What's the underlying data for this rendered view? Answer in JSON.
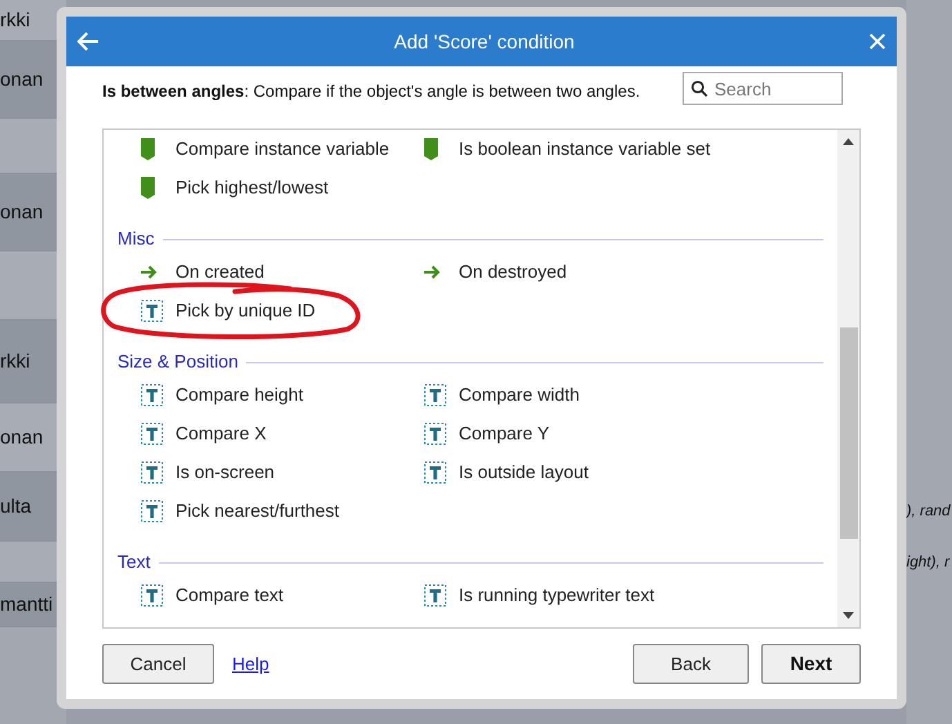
{
  "background": {
    "left_rows": [
      {
        "text": "rkki"
      },
      {
        "text": "onan"
      },
      {
        "text": "onan"
      },
      {
        "text": "rkki"
      },
      {
        "text": "onan"
      },
      {
        "text": "ulta"
      },
      {
        "text": "mantti"
      }
    ],
    "right_rows": [
      {
        "text": "), rand"
      },
      {
        "text": "ight), r"
      }
    ]
  },
  "dialog": {
    "title": "Add 'Score' condition",
    "description": "**Is between angles**: Compare if the object's angle is between two angles.",
    "search": {
      "placeholder": "Search"
    },
    "categories": [
      {
        "items": [
          {
            "kind": "variable",
            "label": "Compare instance variable"
          },
          {
            "kind": "variable",
            "label": "Is boolean instance variable set"
          },
          {
            "kind": "variable",
            "label": "Pick highest/lowest"
          }
        ]
      },
      {
        "title": "Misc",
        "items": [
          {
            "kind": "trigger",
            "label": "On created"
          },
          {
            "kind": "trigger",
            "label": "On destroyed"
          },
          {
            "kind": "behavior",
            "label": "Pick by unique ID"
          }
        ]
      },
      {
        "title": "Size & Position",
        "items": [
          {
            "kind": "behavior",
            "label": "Compare height"
          },
          {
            "kind": "behavior",
            "label": "Compare width"
          },
          {
            "kind": "behavior",
            "label": "Compare X"
          },
          {
            "kind": "behavior",
            "label": "Compare Y"
          },
          {
            "kind": "behavior",
            "label": "Is on-screen"
          },
          {
            "kind": "behavior",
            "label": "Is outside layout"
          },
          {
            "kind": "behavior",
            "label": "Pick nearest/furthest"
          }
        ]
      },
      {
        "title": "Text",
        "items": [
          {
            "kind": "behavior",
            "label": "Compare text"
          },
          {
            "kind": "behavior",
            "label": "Is running typewriter text"
          }
        ]
      }
    ],
    "buttons": {
      "cancel": "Cancel",
      "help": "Help",
      "back": "Back",
      "next": "Next"
    }
  }
}
